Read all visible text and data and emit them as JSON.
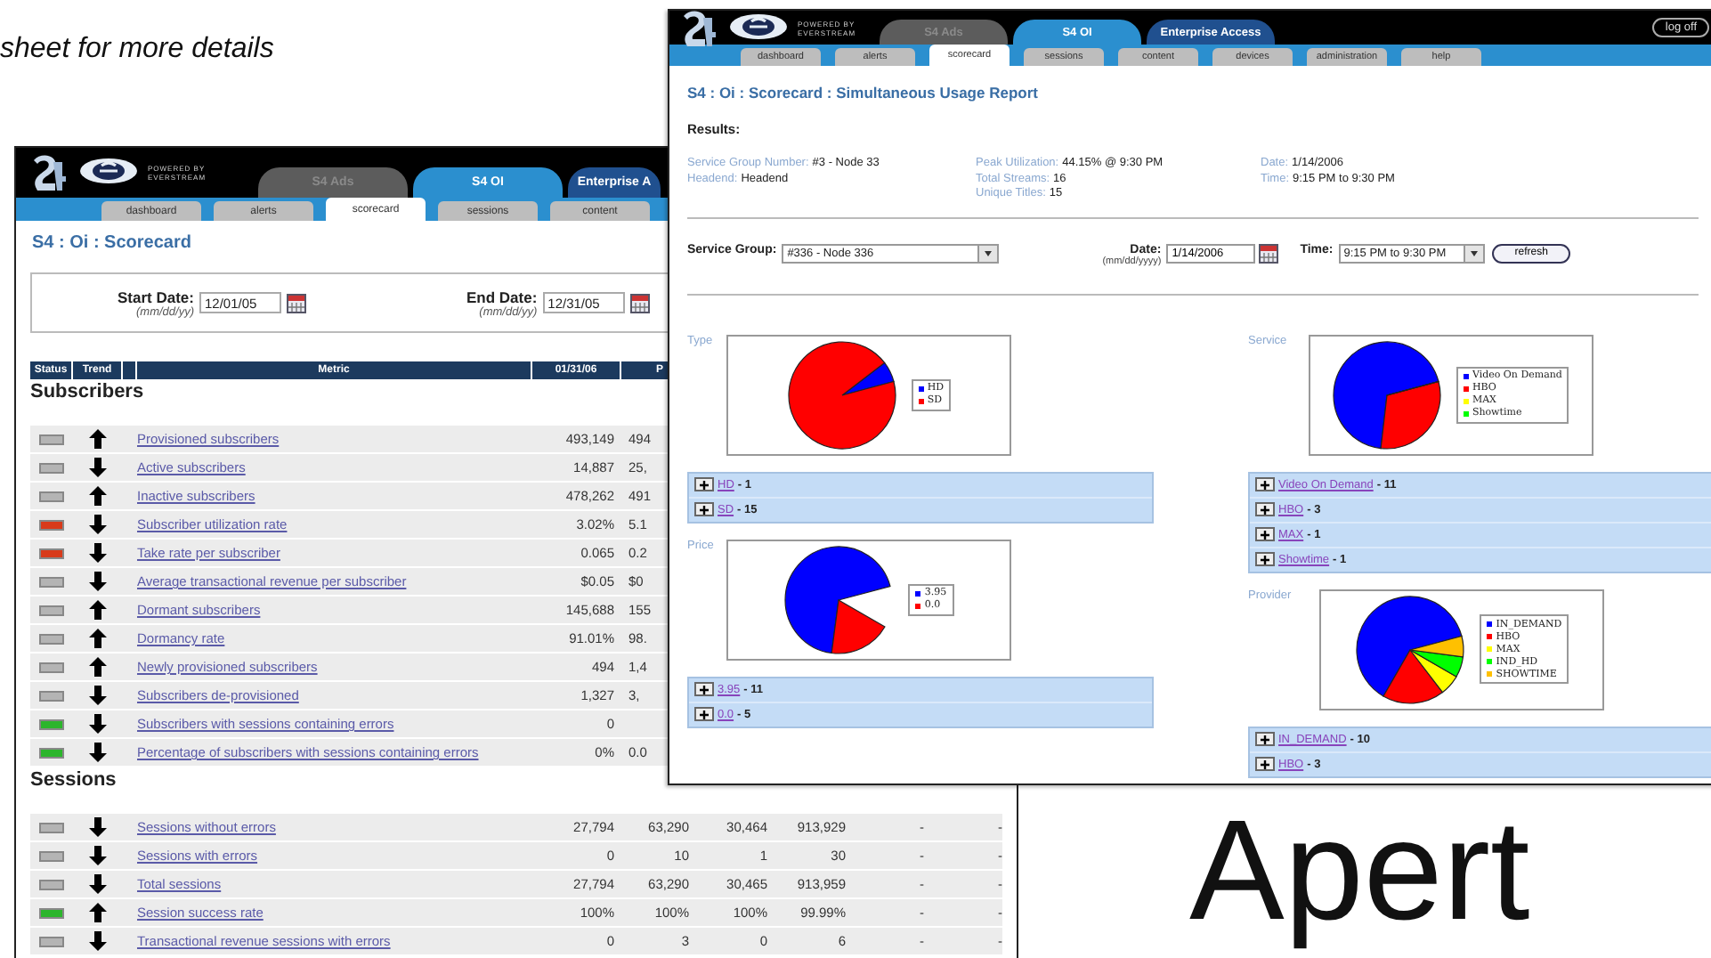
{
  "slide_text": {
    "caption": "sheet for more details",
    "heading": "Apert"
  },
  "back_window": {
    "logo": {
      "line1": "POWERED BY",
      "line2": "EVERSTREAM"
    },
    "tabs": [
      {
        "label": "S4 Ads",
        "selected": false,
        "disabled": true
      },
      {
        "label": "S4 OI",
        "selected": true,
        "disabled": false
      },
      {
        "label": "Enterprise A",
        "selected": false,
        "disabled": false
      }
    ],
    "subtabs": [
      {
        "label": "dashboard",
        "selected": false
      },
      {
        "label": "alerts",
        "selected": false
      },
      {
        "label": "scorecard",
        "selected": true
      },
      {
        "label": "sessions",
        "selected": false
      },
      {
        "label": "content",
        "selected": false
      }
    ],
    "title": "S4 : Oi : Scorecard",
    "start_date": {
      "label": "Start Date:",
      "hint": "(mm/dd/yy)",
      "value": "12/01/05"
    },
    "end_date": {
      "label": "End Date:",
      "hint": "(mm/dd/yy)",
      "value": "12/31/05"
    },
    "table": {
      "columns": [
        "Status",
        "Trend",
        "Metric",
        "01/31/06",
        "P"
      ],
      "sections": [
        {
          "title": "Subscribers",
          "rows": [
            {
              "color": "#b4b4b4",
              "rising": true,
              "metric": "Provisioned subscribers",
              "values": [
                "493,149",
                "494"
              ]
            },
            {
              "color": "#b4b4b4",
              "rising": false,
              "metric": "Active subscribers",
              "values": [
                "14,887",
                "25,"
              ]
            },
            {
              "color": "#b4b4b4",
              "rising": true,
              "metric": "Inactive subscribers",
              "values": [
                "478,262",
                "491"
              ]
            },
            {
              "color": "#d83a1a",
              "rising": false,
              "metric": "Subscriber utilization rate",
              "values": [
                "3.02%",
                "5.1"
              ]
            },
            {
              "color": "#d83a1a",
              "rising": false,
              "metric": "Take rate per subscriber",
              "values": [
                "0.065",
                "0.2"
              ]
            },
            {
              "color": "#b4b4b4",
              "rising": false,
              "metric": "Average transactional revenue per subscriber",
              "values": [
                "$0.05",
                "$0"
              ]
            },
            {
              "color": "#b4b4b4",
              "rising": true,
              "metric": "Dormant subscribers",
              "values": [
                "145,688",
                "155"
              ]
            },
            {
              "color": "#b4b4b4",
              "rising": true,
              "metric": "Dormancy rate",
              "values": [
                "91.01%",
                "98."
              ]
            },
            {
              "color": "#b4b4b4",
              "rising": true,
              "metric": "Newly provisioned subscribers",
              "values": [
                "494",
                "1,4"
              ]
            },
            {
              "color": "#b4b4b4",
              "rising": false,
              "metric": "Subscribers de-provisioned",
              "values": [
                "1,327",
                "3,"
              ]
            },
            {
              "color": "#2cb52c",
              "rising": false,
              "metric": "Subscribers with sessions containing errors",
              "values": [
                "0"
              ]
            },
            {
              "color": "#2cb52c",
              "rising": false,
              "metric": "Percentage of subscribers with sessions containing errors",
              "values": [
                "0%",
                "0.0"
              ]
            }
          ]
        },
        {
          "title": "Sessions",
          "rows": [
            {
              "color": "#b4b4b4",
              "rising": false,
              "metric": "Sessions without errors",
              "values": [
                "27,794",
                "63,290",
                "30,464",
                "913,929",
                "-",
                "-"
              ]
            },
            {
              "color": "#b4b4b4",
              "rising": false,
              "metric": "Sessions with errors",
              "values": [
                "0",
                "10",
                "1",
                "30",
                "-",
                "-"
              ]
            },
            {
              "color": "#b4b4b4",
              "rising": false,
              "metric": "Total sessions",
              "values": [
                "27,794",
                "63,290",
                "30,465",
                "913,959",
                "-",
                "-"
              ]
            },
            {
              "color": "#2cb52c",
              "rising": true,
              "metric": "Session success rate",
              "values": [
                "100%",
                "100%",
                "100%",
                "99.99%",
                "-",
                "-"
              ]
            },
            {
              "color": "#b4b4b4",
              "rising": false,
              "metric": "Transactional revenue sessions with errors",
              "values": [
                "0",
                "3",
                "0",
                "6",
                "-",
                "-"
              ]
            }
          ]
        }
      ]
    }
  },
  "front_window": {
    "logo": {
      "line1": "POWERED BY",
      "line2": "EVERSTREAM"
    },
    "tabs": [
      {
        "label": "S4 Ads",
        "selected": false,
        "disabled": true
      },
      {
        "label": "S4 OI",
        "selected": true,
        "disabled": false
      },
      {
        "label": "Enterprise Access",
        "selected": false,
        "disabled": false
      }
    ],
    "log_off": "log off",
    "subtabs": [
      {
        "label": "dashboard",
        "selected": false
      },
      {
        "label": "alerts",
        "selected": false
      },
      {
        "label": "scorecard",
        "selected": true
      },
      {
        "label": "sessions",
        "selected": false
      },
      {
        "label": "content",
        "selected": false
      },
      {
        "label": "devices",
        "selected": false
      },
      {
        "label": "administration",
        "selected": false
      },
      {
        "label": "help",
        "selected": false
      }
    ],
    "title": "S4 : Oi : Scorecard : Simultaneous Usage Report",
    "results_label": "Results:",
    "summary": [
      [
        {
          "label": "Service Group Number:",
          "value": "#3 - Node 33"
        },
        {
          "label": "Headend:",
          "value": "Headend"
        }
      ],
      [
        {
          "label": "Peak Utilization:",
          "value": "44.15% @ 9:30 PM"
        },
        {
          "label": "Total Streams:",
          "value": "16"
        },
        {
          "label": "Unique Titles:",
          "value": "15"
        }
      ],
      [
        {
          "label": "Date:",
          "value": "1/14/2006"
        },
        {
          "label": "Time:",
          "value": "9:15 PM to 9:30 PM"
        }
      ]
    ],
    "filters": {
      "service_group": {
        "label": "Service Group:",
        "value": "#336 - Node 336"
      },
      "date": {
        "label": "Date:",
        "hint": "(mm/dd/yyyy)",
        "value": "1/14/2006"
      },
      "time": {
        "label": "Time:",
        "value": "9:15 PM to 9:30 PM"
      },
      "refresh": "refresh"
    },
    "panel_columns": [
      [
        {
          "title": "Type",
          "legend": [
            {
              "label": "HD",
              "color": "#0000ff"
            },
            {
              "label": "SD",
              "color": "#ff0000"
            }
          ],
          "items": [
            {
              "label": "HD",
              "count": "- 1"
            },
            {
              "label": "SD",
              "count": "- 15"
            }
          ]
        },
        {
          "title": "Price",
          "legend": [
            {
              "label": "3.95",
              "color": "#0000ff"
            },
            {
              "label": "0.0",
              "color": "#ff0000"
            }
          ],
          "items": [
            {
              "label": "3.95",
              "count": "- 11"
            },
            {
              "label": "0.0",
              "count": "- 5"
            }
          ]
        }
      ],
      [
        {
          "title": "Service",
          "legend": [
            {
              "label": "Video On Demand",
              "color": "#0000ff"
            },
            {
              "label": "HBO",
              "color": "#ff0000"
            },
            {
              "label": "MAX",
              "color": "#ffff00"
            },
            {
              "label": "Showtime",
              "color": "#00ff00"
            }
          ],
          "items": [
            {
              "label": "Video On Demand",
              "count": "- 11"
            },
            {
              "label": "HBO",
              "count": "- 3"
            },
            {
              "label": "MAX",
              "count": "- 1"
            },
            {
              "label": "Showtime",
              "count": "- 1"
            }
          ]
        },
        {
          "title": "Provider",
          "legend": [
            {
              "label": "IN_DEMAND",
              "color": "#0000ff"
            },
            {
              "label": "HBO",
              "color": "#ff0000"
            },
            {
              "label": "MAX",
              "color": "#ffff00"
            },
            {
              "label": "IND_HD",
              "color": "#00ff00"
            },
            {
              "label": "SHOWTIME",
              "color": "#ffc000"
            }
          ],
          "items": [
            {
              "label": "IN_DEMAND",
              "count": "- 10"
            },
            {
              "label": "HBO",
              "count": "- 3"
            }
          ]
        }
      ]
    ]
  }
}
